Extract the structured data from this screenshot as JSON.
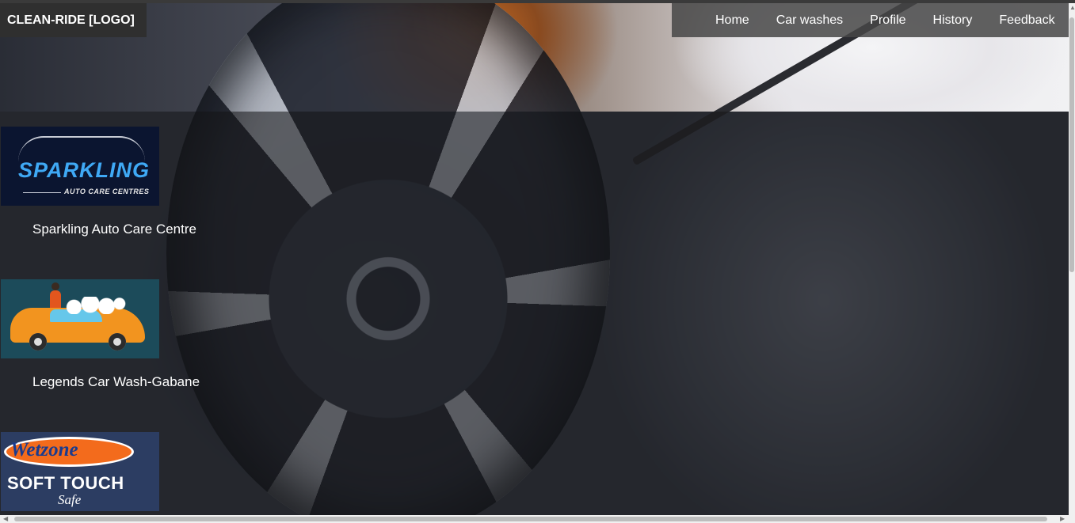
{
  "header": {
    "logo_text": "CLEAN-RIDE [LOGO]",
    "nav": {
      "home": "Home",
      "car_washes": "Car washes",
      "profile": "Profile",
      "history": "History",
      "feedback": "Feedback"
    }
  },
  "listings": [
    {
      "name": "Sparkling Auto Care Centre",
      "logo_text": "SPARKLING",
      "logo_subtext": "AUTO CARE CENTRES"
    },
    {
      "name": "Legends Car Wash-Gabane"
    },
    {
      "logo_text": "Wetzone",
      "logo_subtext": "SOFT TOUCH",
      "logo_tagline": "Safe"
    }
  ],
  "colors": {
    "header_bg": "#2f2f2f",
    "nav_bg": "#464646",
    "text": "#ffffff",
    "overlay": "#141416"
  }
}
